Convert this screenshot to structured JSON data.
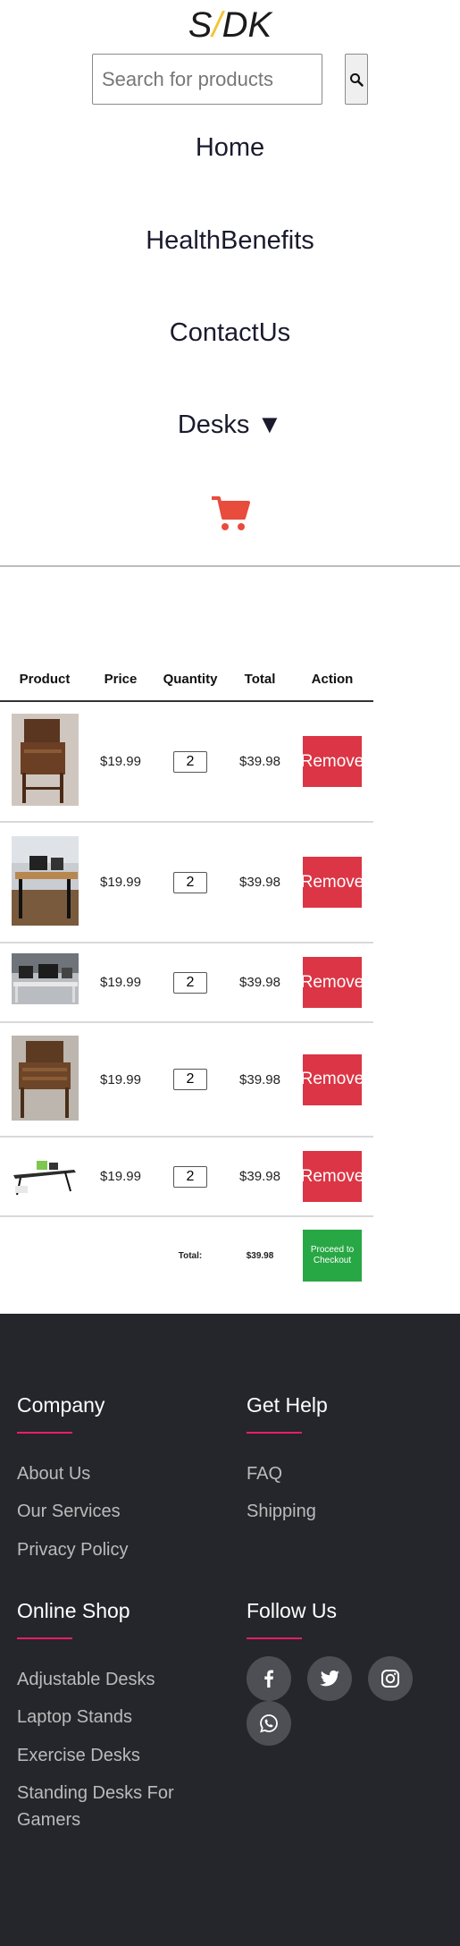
{
  "header": {
    "logo_s": "S",
    "logo_slash": "/",
    "logo_dk": "DK",
    "search_placeholder": "Search for products"
  },
  "nav": {
    "items": [
      "Home",
      "HealthBenefits",
      "ContactUs"
    ],
    "desks_label": "Desks ▼"
  },
  "cart_table": {
    "headers": [
      "Product",
      "Price",
      "Quantity",
      "Total",
      "Action"
    ],
    "rows": [
      {
        "product_image": "antique-secretary-desk",
        "price": "$19.99",
        "quantity": "2",
        "total": "$39.98",
        "action": "Remove"
      },
      {
        "product_image": "office-standing-desk",
        "price": "$19.99",
        "quantity": "2",
        "total": "$39.98",
        "action": "Remove"
      },
      {
        "product_image": "workspace-desk",
        "price": "$19.99",
        "quantity": "2",
        "total": "$39.98",
        "action": "Remove"
      },
      {
        "product_image": "antique-wooden-desk",
        "price": "$19.99",
        "quantity": "2",
        "total": "$39.98",
        "action": "Remove"
      },
      {
        "product_image": "modern-glass-desk",
        "price": "$19.99",
        "quantity": "2",
        "total": "$39.98",
        "action": "Remove"
      }
    ],
    "total_label": "Total:",
    "total_value": "$39.98",
    "checkout_label": "Proceed to Checkout"
  },
  "footer": {
    "company": {
      "heading": "Company",
      "links": [
        "About Us",
        "Our Services",
        "Privacy Policy"
      ]
    },
    "get_help": {
      "heading": "Get Help",
      "links": [
        "FAQ",
        "Shipping"
      ]
    },
    "online_shop": {
      "heading": "Online Shop",
      "links": [
        "Adjustable Desks",
        "Laptop Stands",
        "Exercise Desks",
        "Standing Desks For Gamers"
      ]
    },
    "follow_us": {
      "heading": "Follow Us",
      "icons": [
        "facebook-icon",
        "twitter-icon",
        "instagram-icon",
        "whatsapp-icon"
      ]
    }
  },
  "colors": {
    "accent": "#e91e63",
    "remove": "#dc3545",
    "checkout": "#28a745",
    "footer_bg": "#24262b",
    "cart": "#e74c3c",
    "logo_slash": "#f4c430"
  }
}
